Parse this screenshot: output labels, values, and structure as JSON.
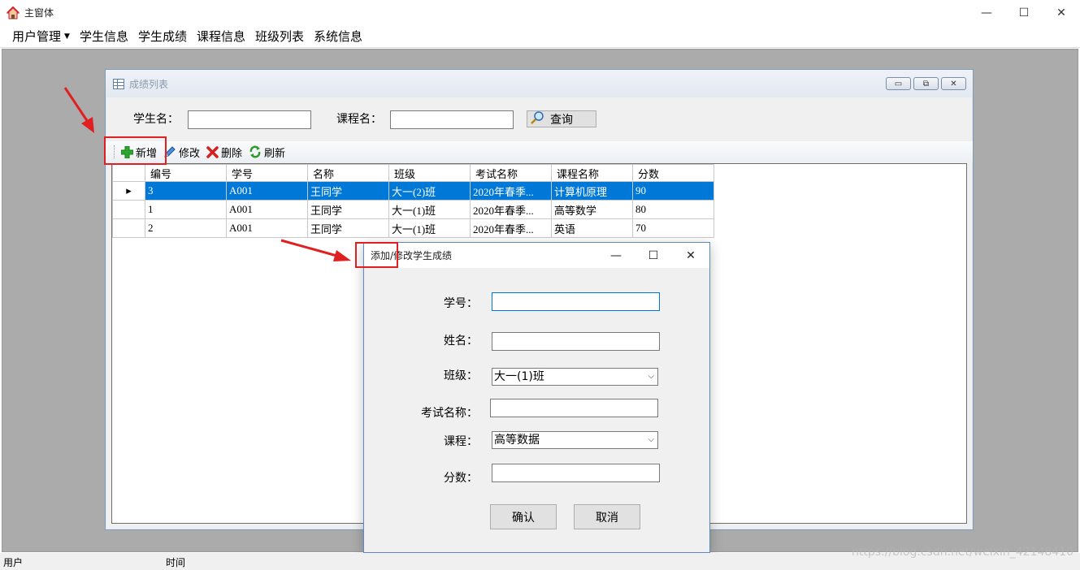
{
  "main_window": {
    "title": "主窗体",
    "min_symbol": "—",
    "max_symbol": "☐",
    "close_symbol": "✕"
  },
  "menu": {
    "items": [
      "用户管理",
      "学生信息",
      "学生成绩",
      "课程信息",
      "班级列表",
      "系统信息"
    ]
  },
  "child_window": {
    "title": "成绩列表",
    "search": {
      "student_label": "学生名：",
      "course_label": "课程名：",
      "student_value": "",
      "course_value": "",
      "query_label": "查询"
    },
    "toolbar": {
      "add": "新增",
      "edit": "修改",
      "delete": "删除",
      "refresh": "刷新"
    },
    "grid": {
      "columns": [
        "编号",
        "学号",
        "名称",
        "班级",
        "考试名称",
        "课程名称",
        "分数"
      ],
      "rows": [
        [
          "3",
          "A001",
          "王同学",
          "大一(2)班",
          "2020年春季...",
          "计算机原理",
          "90"
        ],
        [
          "1",
          "A001",
          "王同学",
          "大一(1)班",
          "2020年春季...",
          "高等数学",
          "80"
        ],
        [
          "2",
          "A001",
          "王同学",
          "大一(1)班",
          "2020年春季...",
          "英语",
          "70"
        ]
      ],
      "selected_row_marker": "▸"
    }
  },
  "dialog": {
    "title": "添加/修改学生成绩",
    "fields": {
      "student_no_label": "学号：",
      "name_label": "姓名：",
      "class_label": "班级：",
      "exam_label": "考试名称：",
      "course_label": "课程：",
      "score_label": "分数："
    },
    "values": {
      "student_no": "",
      "name": "",
      "class_selected": "大一(1)班",
      "exam": "",
      "course_selected": "高等数据",
      "score": ""
    },
    "confirm_label": "确认",
    "cancel_label": "取消"
  },
  "statusbar": {
    "user_label": "用户",
    "time_label": "时间"
  },
  "watermark": "https://blog.csdn.net/weixin_42148410",
  "colors": {
    "selection": "#0078d7",
    "annotation_red": "#e02020",
    "mdi_background": "#ababab"
  }
}
